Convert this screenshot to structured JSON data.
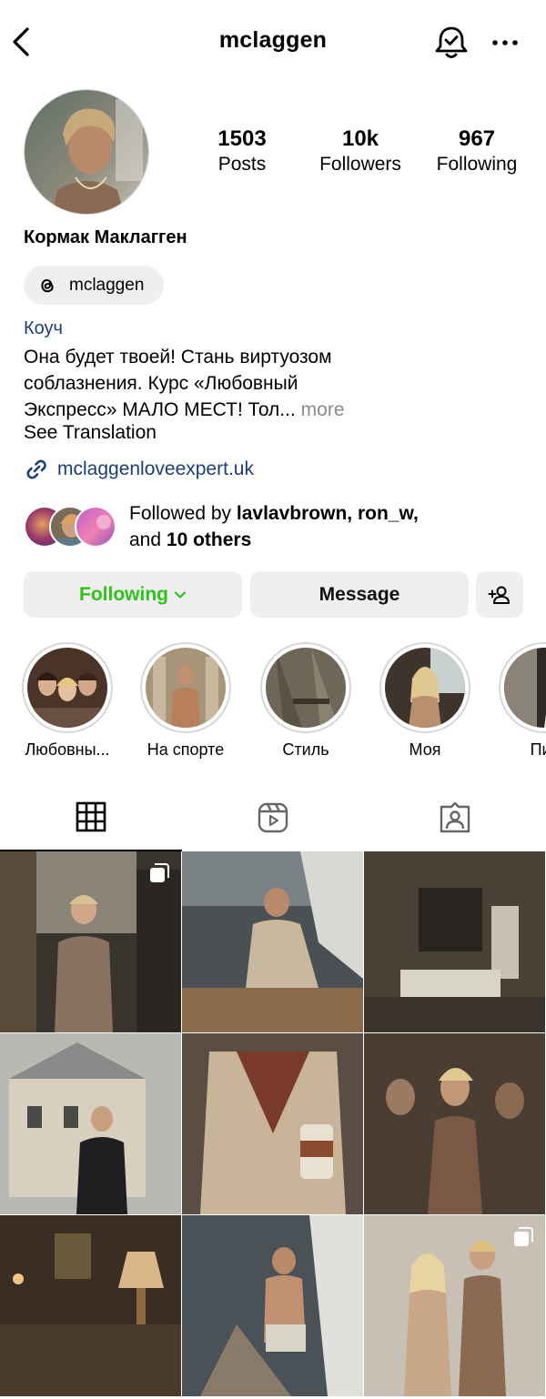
{
  "header": {
    "username": "mclaggen"
  },
  "profile": {
    "full_name": "Кормак Маклагген",
    "stats": {
      "posts_count": "1503",
      "posts_label": "Posts",
      "followers_count": "10k",
      "followers_label": "Followers",
      "following_count": "967",
      "following_label": "Following"
    },
    "threads_handle": "mclaggen",
    "category": "Коуч",
    "bio_line1": "Она будет твоей! Стань виртуозом",
    "bio_line2": "соблазнения. Курс «Любовный",
    "bio_line3": "Экспресс» МАЛО МЕСТ! Тол...",
    "bio_more": "more",
    "see_translation": "See Translation",
    "website": "mclaggenloveexpert.uk",
    "followed_by_prefix": "Followed by",
    "followed_by_names": "lavlavbrown, ron_w,",
    "followed_by_and": "and",
    "followed_by_others": "10 others"
  },
  "actions": {
    "following_label": "Following",
    "message_label": "Message"
  },
  "highlights": [
    {
      "label": "Любовны..."
    },
    {
      "label": "На спорте"
    },
    {
      "label": "Стиль"
    },
    {
      "label": "Моя"
    },
    {
      "label": "Пик"
    }
  ],
  "icons": {
    "back": "chevron-left-icon",
    "bell": "notification-bell-icon",
    "more": "more-dots-icon",
    "threads": "threads-icon",
    "link": "link-icon",
    "add_user": "add-user-icon",
    "grid_tab": "grid-icon",
    "reels_tab": "reels-icon",
    "tagged_tab": "tagged-icon",
    "multi_post": "carousel-icon"
  },
  "colors": {
    "following_green": "#2cc418",
    "link_blue": "#1a3f78",
    "more_gray": "#8a8a8a",
    "button_bg": "#efefef"
  }
}
